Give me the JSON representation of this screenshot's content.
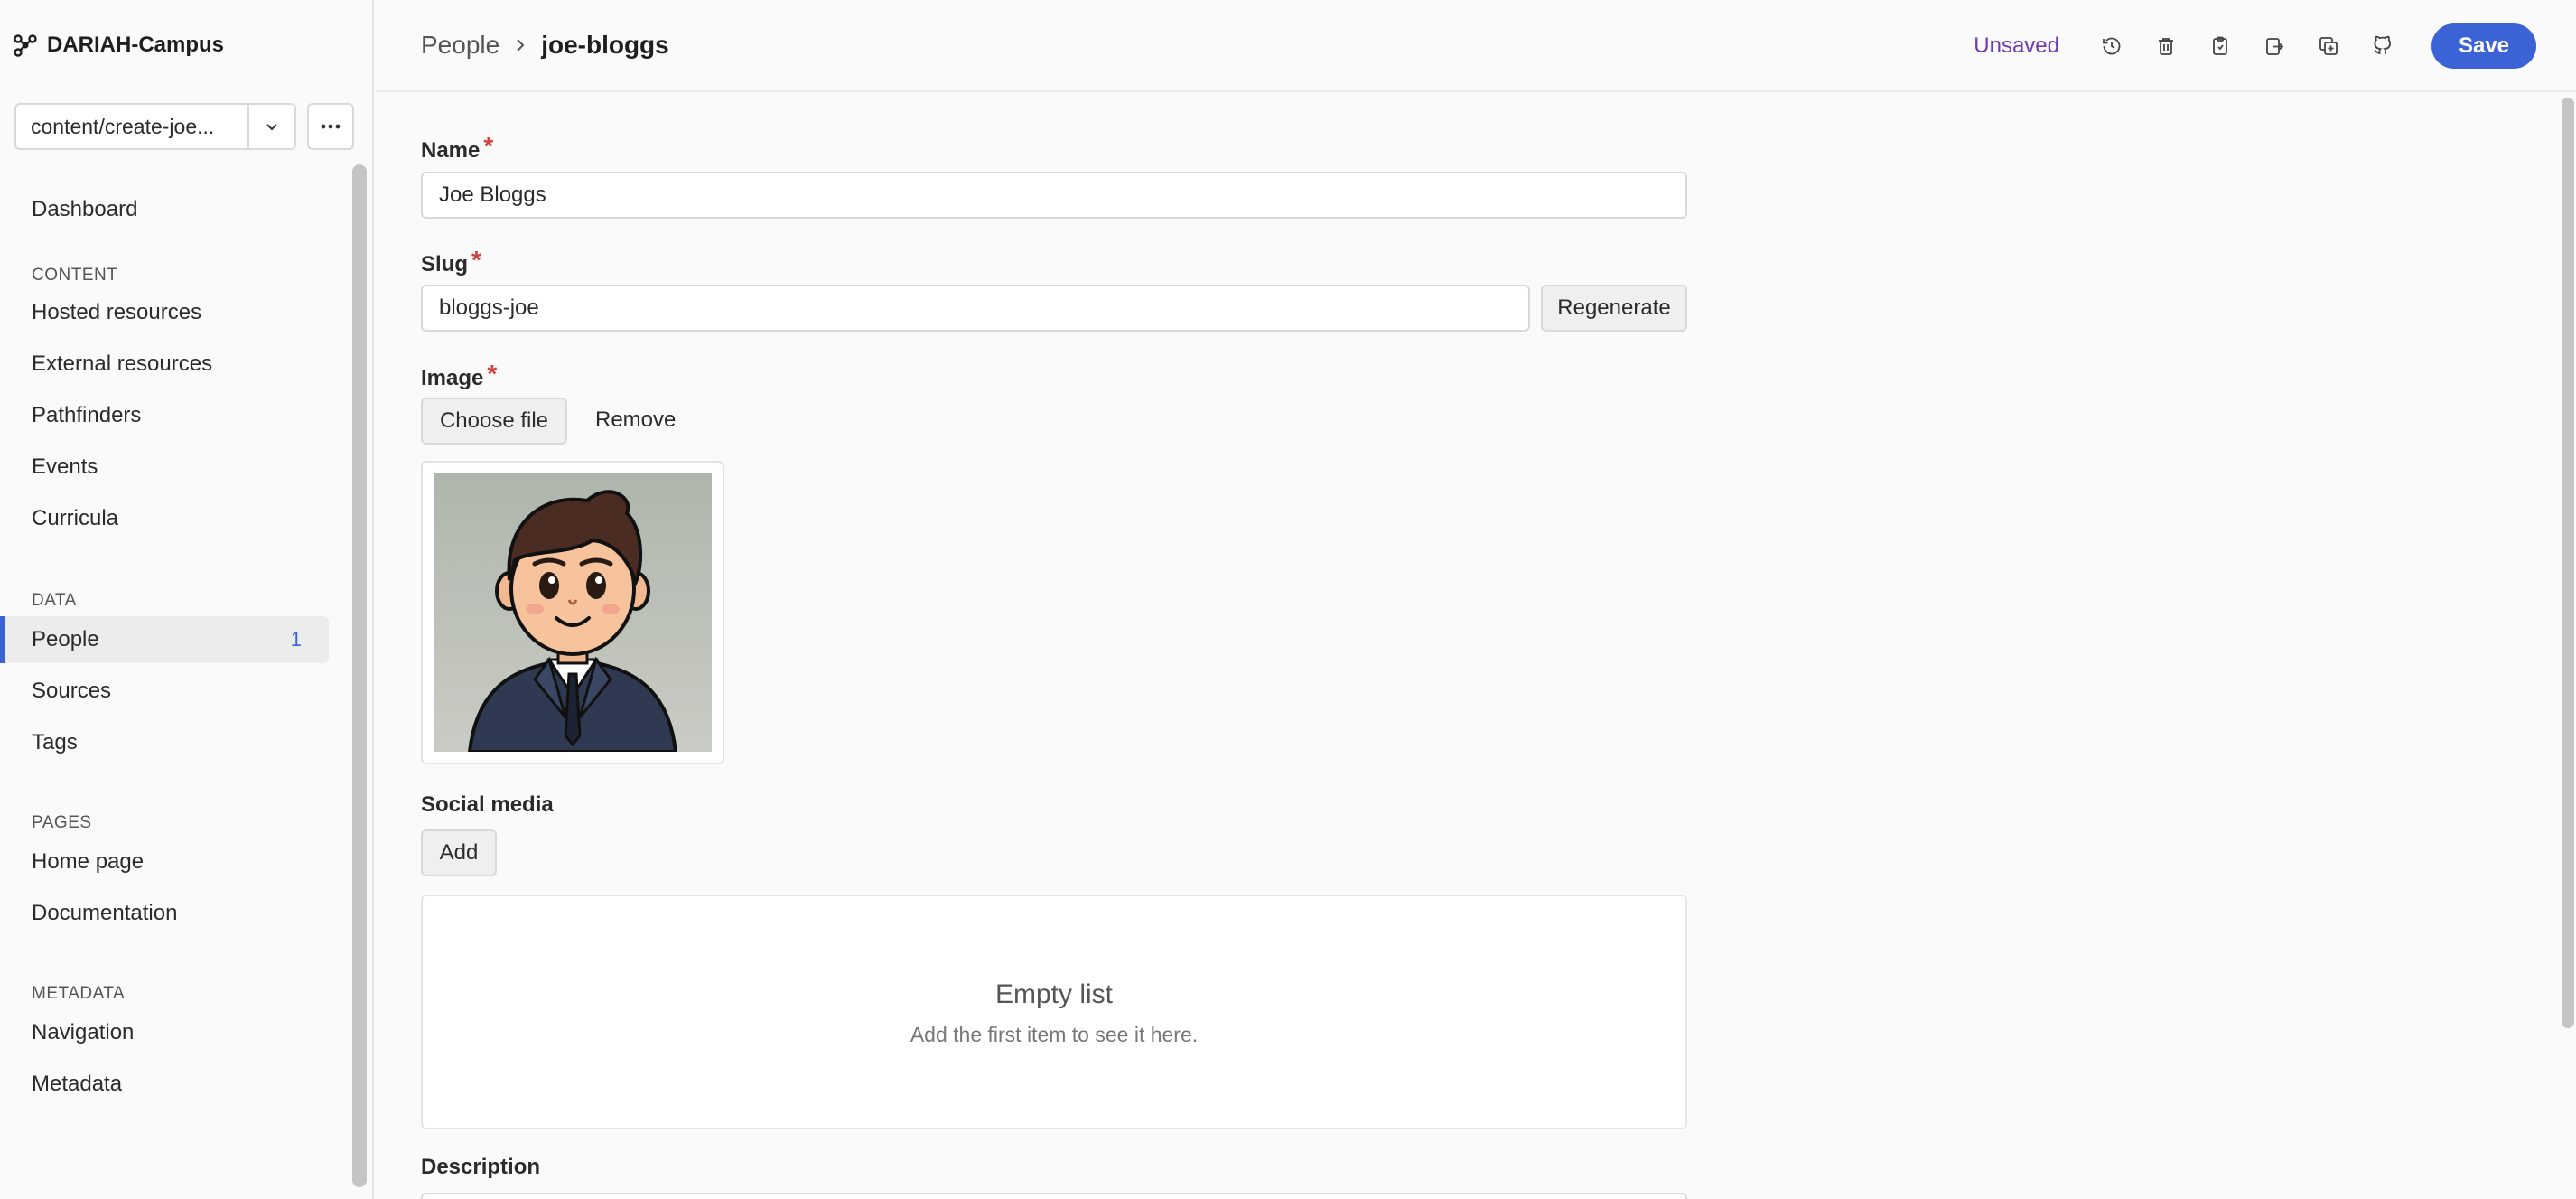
{
  "app": {
    "name": "DARIAH-Campus"
  },
  "branch": {
    "label": "content/create-joe..."
  },
  "sidebar": {
    "dashboard": "Dashboard",
    "sections": [
      {
        "heading": "CONTENT",
        "items": [
          "Hosted resources",
          "External resources",
          "Pathfinders",
          "Events",
          "Curricula"
        ]
      },
      {
        "heading": "DATA",
        "items": [
          "People",
          "Sources",
          "Tags"
        ]
      },
      {
        "heading": "PAGES",
        "items": [
          "Home page",
          "Documentation"
        ]
      },
      {
        "heading": "METADATA",
        "items": [
          "Navigation",
          "Metadata"
        ]
      }
    ],
    "active_item": "People",
    "people_badge": "1"
  },
  "header": {
    "breadcrumb_parent": "People",
    "breadcrumb_current": "joe-bloggs",
    "status": "Unsaved",
    "save_label": "Save",
    "tool_icons": [
      "history-icon",
      "trash-icon",
      "clipboard-icon",
      "export-icon",
      "duplicate-icon",
      "github-icon"
    ],
    "accent_color": "#3b63d6",
    "status_color": "#6d3bb6"
  },
  "form": {
    "name_label": "Name",
    "name_value": "Joe Bloggs",
    "slug_label": "Slug",
    "slug_value": "bloggs-joe",
    "regenerate_label": "Regenerate",
    "image_label": "Image",
    "choose_file_label": "Choose file",
    "remove_label": "Remove",
    "social_label": "Social media",
    "add_label": "Add",
    "empty_title": "Empty list",
    "empty_subtitle": "Add the first item to see it here.",
    "description_label": "Description",
    "required_mark": "*"
  }
}
